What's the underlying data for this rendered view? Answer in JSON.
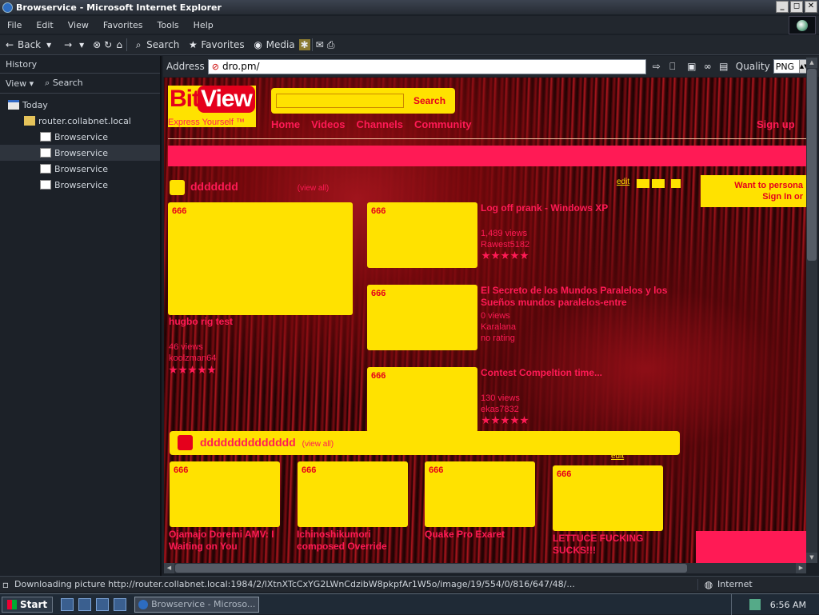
{
  "window": {
    "title": "Browservice - Microsoft Internet Explorer",
    "btn_min": "_",
    "btn_max": "◻",
    "btn_close": "✕"
  },
  "menu": [
    "File",
    "Edit",
    "View",
    "Favorites",
    "Tools",
    "Help"
  ],
  "toolbar": {
    "back": "Back",
    "search": "Search",
    "favorites": "Favorites",
    "media": "Media"
  },
  "history": {
    "title": "History",
    "view": "View",
    "search": "Search",
    "tree": [
      {
        "label": "Today",
        "level": 0,
        "icon": "calendar-icon"
      },
      {
        "label": "router.collabnet.local",
        "level": 1,
        "icon": "folder-icon"
      },
      {
        "label": "Browservice",
        "level": 2,
        "icon": "page-icon"
      },
      {
        "label": "Browservice",
        "level": 2,
        "icon": "page-icon"
      },
      {
        "label": "Browservice",
        "level": 2,
        "icon": "page-icon"
      },
      {
        "label": "Browservice",
        "level": 2,
        "icon": "page-icon"
      }
    ]
  },
  "address": {
    "label": "Address",
    "value": "dro.pm/",
    "quality_label": "Quality",
    "quality_value": "PNG"
  },
  "site": {
    "logo_bit": "Bit",
    "logo_view": "View",
    "tagline": "Express Yourself ™",
    "search_btn": "Search",
    "nav": [
      "Home",
      "Videos",
      "Channels",
      "Community"
    ],
    "nav_right": "Sign up",
    "section1": {
      "title": "ddddddd",
      "view_all": "(view all)",
      "edit": "edit"
    },
    "side_box": {
      "line1": "Want to persona",
      "line2": "Sign In or"
    },
    "featured": {
      "alt": "666",
      "title": "hugbo rig test",
      "views": "46 views",
      "user": "koolzman64"
    },
    "videos": [
      {
        "alt": "666",
        "title": "Log off prank - Windows XP",
        "views": "1,489 views",
        "user": "Rawest5182"
      },
      {
        "alt": "666",
        "title": "El Secreto de los Mundos Paralelos y los Sueños mundos paralelos-entre",
        "views": "0 views",
        "user": "Karalana",
        "rating": "no rating"
      },
      {
        "alt": "666",
        "title": "Contest Compeltion time...",
        "views": "130 views",
        "user": "ekas7832"
      }
    ],
    "section2": {
      "title": "dddddddddddddd",
      "view_all": "(view all)",
      "edit": "edit"
    },
    "row2": [
      {
        "alt": "666",
        "title": "Ojamajo Doremi AMV: I Waiting on You"
      },
      {
        "alt": "666",
        "title": "Ichinoshikumori composed Override"
      },
      {
        "alt": "666",
        "title": "Quake Pro Exaret"
      },
      {
        "alt": "666",
        "title": "LETTUCE FUCKING SUCKS!!!"
      }
    ]
  },
  "status": {
    "message": "Downloading picture http://router.collabnet.local:1984/2/lXtnXTcCxYG2LWnCdzibW8pkpfAr1W5o/image/19/554/0/816/647/48/...",
    "zone": "Internet"
  },
  "taskbar": {
    "start": "Start",
    "task": "Browservice - Microso...",
    "time": "6:56 AM"
  }
}
